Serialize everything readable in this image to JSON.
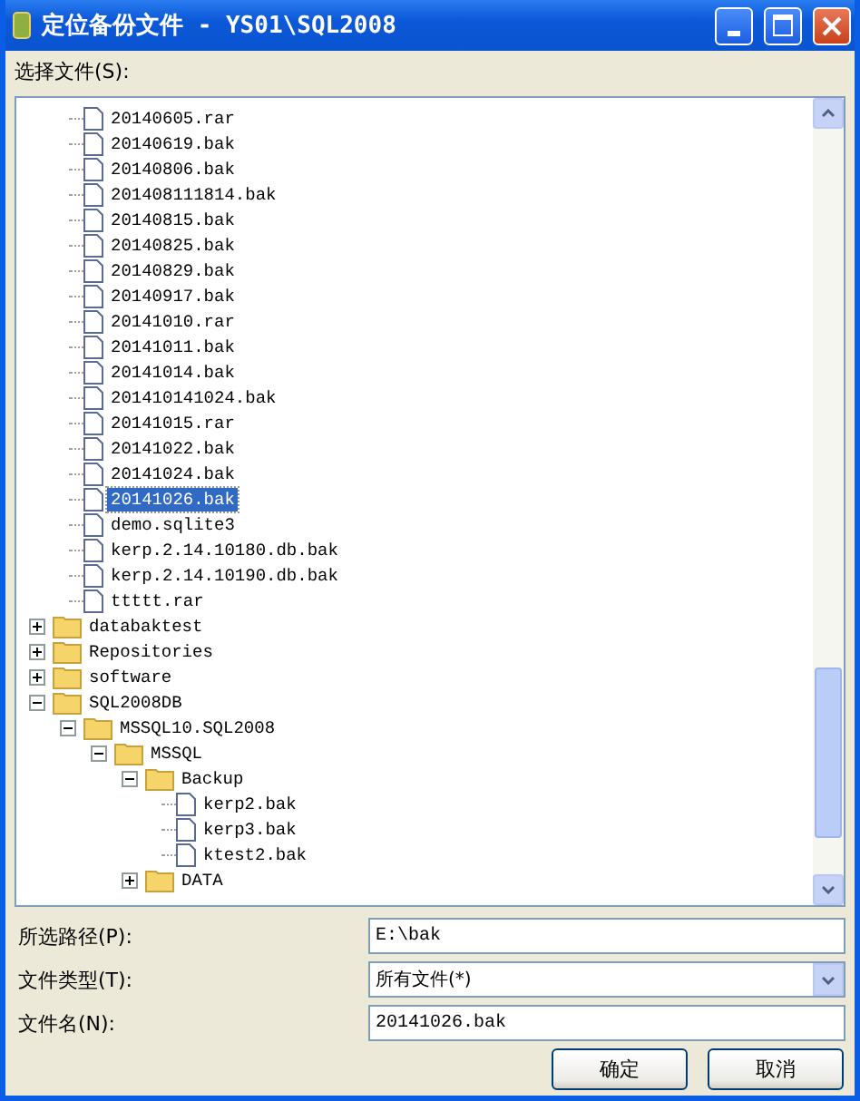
{
  "window": {
    "title": "定位备份文件 - YS01\\SQL2008"
  },
  "tree_label": "选择文件(S):",
  "tree": [
    {
      "children": [
        {
          "kind": "file",
          "label": "20140605.rar",
          "selected": false
        },
        {
          "kind": "file",
          "label": "20140619.bak",
          "selected": false
        },
        {
          "kind": "file",
          "label": "20140806.bak",
          "selected": false
        },
        {
          "kind": "file",
          "label": "201408111814.bak",
          "selected": false
        },
        {
          "kind": "file",
          "label": "20140815.bak",
          "selected": false
        },
        {
          "kind": "file",
          "label": "20140825.bak",
          "selected": false
        },
        {
          "kind": "file",
          "label": "20140829.bak",
          "selected": false
        },
        {
          "kind": "file",
          "label": "20140917.bak",
          "selected": false
        },
        {
          "kind": "file",
          "label": "20141010.rar",
          "selected": false
        },
        {
          "kind": "file",
          "label": "20141011.bak",
          "selected": false
        },
        {
          "kind": "file",
          "label": "20141014.bak",
          "selected": false
        },
        {
          "kind": "file",
          "label": "201410141024.bak",
          "selected": false
        },
        {
          "kind": "file",
          "label": "20141015.rar",
          "selected": false
        },
        {
          "kind": "file",
          "label": "20141022.bak",
          "selected": false
        },
        {
          "kind": "file",
          "label": "20141024.bak",
          "selected": false
        },
        {
          "kind": "file",
          "label": "20141026.bak",
          "selected": true
        },
        {
          "kind": "file",
          "label": "demo.sqlite3",
          "selected": false
        },
        {
          "kind": "file",
          "label": "kerp.2.14.10180.db.bak",
          "selected": false
        },
        {
          "kind": "file",
          "label": "kerp.2.14.10190.db.bak",
          "selected": false
        },
        {
          "kind": "file",
          "label": "ttttt.rar",
          "selected": false
        }
      ]
    },
    {
      "kind": "folder",
      "label": "databaktest",
      "expanded": false,
      "selected": false
    },
    {
      "kind": "folder",
      "label": "Repositories",
      "expanded": false,
      "selected": false
    },
    {
      "kind": "folder",
      "label": "software",
      "expanded": false,
      "selected": false
    },
    {
      "kind": "folder",
      "label": "SQL2008DB",
      "expanded": true,
      "selected": false,
      "children": [
        {
          "kind": "folder",
          "label": "MSSQL10.SQL2008",
          "expanded": true,
          "selected": false,
          "children": [
            {
              "kind": "folder",
              "label": "MSSQL",
              "expanded": true,
              "selected": false,
              "children": [
                {
                  "kind": "folder",
                  "label": "Backup",
                  "expanded": true,
                  "selected": false,
                  "children": [
                    {
                      "kind": "file",
                      "label": "kerp2.bak",
                      "selected": false
                    },
                    {
                      "kind": "file",
                      "label": "kerp3.bak",
                      "selected": false
                    },
                    {
                      "kind": "file",
                      "label": "ktest2.bak",
                      "selected": false
                    }
                  ]
                },
                {
                  "kind": "folder",
                  "label": "DATA",
                  "expanded": false,
                  "selected": false
                }
              ]
            }
          ]
        }
      ]
    }
  ],
  "fields": [
    {
      "kind": "text",
      "label": "所选路径(P):",
      "value": "E:\\bak"
    },
    {
      "kind": "select",
      "label": "文件类型(T):",
      "value": "所有文件(*)"
    },
    {
      "kind": "text",
      "label": "文件名(N):",
      "value": "20141026.bak"
    }
  ],
  "buttons": [
    "确定",
    "取消"
  ]
}
